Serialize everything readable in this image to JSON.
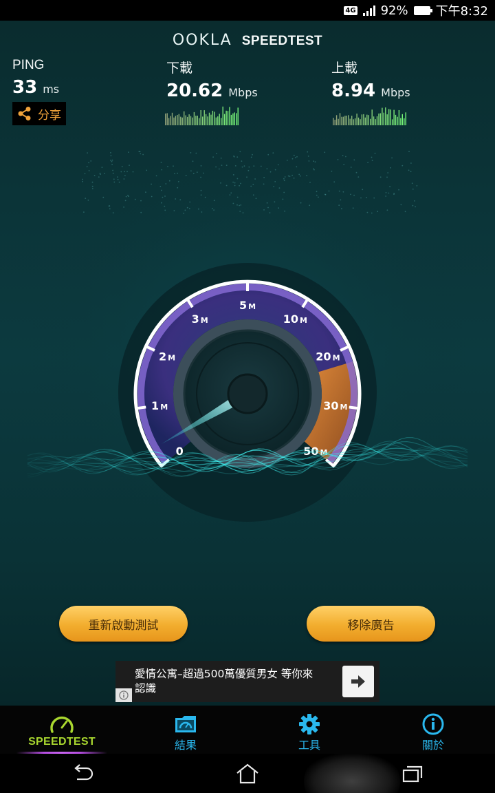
{
  "status_bar": {
    "network": "4G",
    "battery": "92%",
    "time": "下午8:32"
  },
  "header": {
    "logo_left": "OOKLA",
    "logo_right": "SPEEDTEST"
  },
  "metrics": {
    "ping": {
      "label": "PING",
      "value": "33",
      "unit": "ms"
    },
    "download": {
      "label": "下載",
      "value": "20.62",
      "unit": "Mbps"
    },
    "upload": {
      "label": "上載",
      "value": "8.94",
      "unit": "Mbps"
    }
  },
  "share_label": "分享",
  "gauge": {
    "tick_labels": [
      {
        "text": "0",
        "unit": ""
      },
      {
        "text": "1",
        "unit": "M"
      },
      {
        "text": "2",
        "unit": "M"
      },
      {
        "text": "3",
        "unit": "M"
      },
      {
        "text": "5",
        "unit": "M"
      },
      {
        "text": "10",
        "unit": "M"
      },
      {
        "text": "20",
        "unit": "M"
      },
      {
        "text": "30",
        "unit": "M"
      },
      {
        "text": "50",
        "unit": "M"
      }
    ],
    "needle_value_mbps": 0.3,
    "colors": {
      "arc": "#ffffff",
      "ring": "#8a6dd8",
      "fill": "#3a3f8a",
      "danger": "#c26d2a",
      "glow": "#2ee0e0"
    }
  },
  "buttons": {
    "restart": "重新啟動測試",
    "remove_ads": "移除廣告"
  },
  "ad": {
    "text_line1": "愛情公寓–超過500萬優質男女 等你來",
    "text_line2": "認識",
    "arrow_icon": "arrow-right-icon",
    "info_icon": "info-icon"
  },
  "bottom_nav": [
    {
      "label": "SPEEDTEST",
      "icon": "gauge-icon",
      "active": true
    },
    {
      "label": "結果",
      "icon": "results-icon",
      "active": false
    },
    {
      "label": "工具",
      "icon": "gear-icon",
      "active": false
    },
    {
      "label": "關於",
      "icon": "info-icon",
      "active": false
    }
  ],
  "colors": {
    "accent_cyan": "#2ab8ee",
    "accent_green": "#a9d72f",
    "button_orange": "#f2ad2e",
    "background": "#0b3438"
  }
}
